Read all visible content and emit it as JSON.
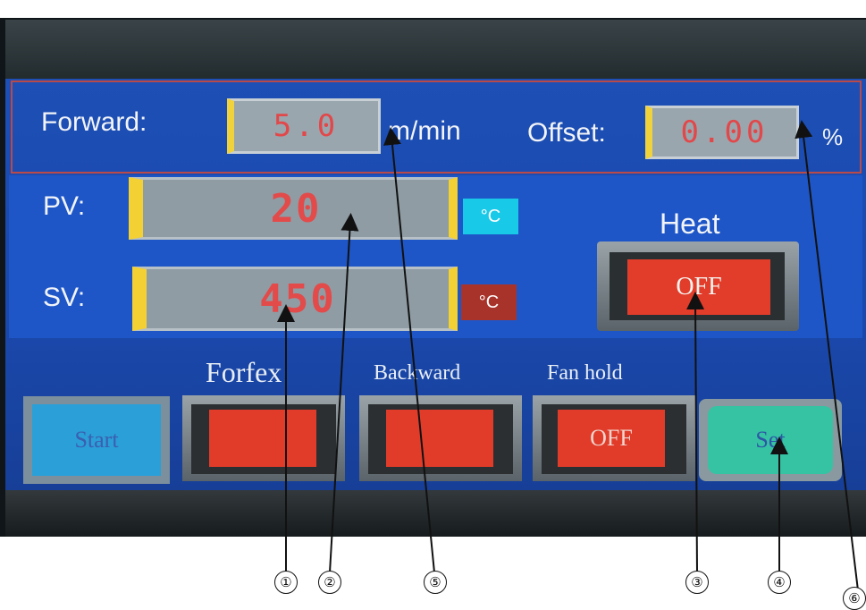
{
  "panel": {
    "forward_label": "Forward:",
    "forward_value": "5.0",
    "forward_unit": "m/min",
    "offset_label": "Offset:",
    "offset_value": "0.00",
    "offset_unit": "%",
    "pv_label": "PV:",
    "pv_value": "20",
    "pv_unit": "°C",
    "sv_label": "SV:",
    "sv_value": "450",
    "sv_unit": "°C",
    "heat_label": "Heat",
    "heat_state": "OFF"
  },
  "keys": {
    "start": "Start",
    "forfex_label": "Forfex",
    "backward_label": "Backward",
    "fan_hold_label": "Fan hold",
    "fan_hold_state": "OFF",
    "set": "Set"
  },
  "callouts": [
    "①",
    "②",
    "⑤",
    "③",
    "④",
    "⑥"
  ],
  "colors": {
    "screen": "#1d4fb5",
    "button_red": "#e13c2a",
    "digit_red": "#e2474a",
    "pv_unit_chip": "#19c9e8",
    "sv_unit_chip": "#a8332a",
    "set_green": "#35c3a4"
  }
}
